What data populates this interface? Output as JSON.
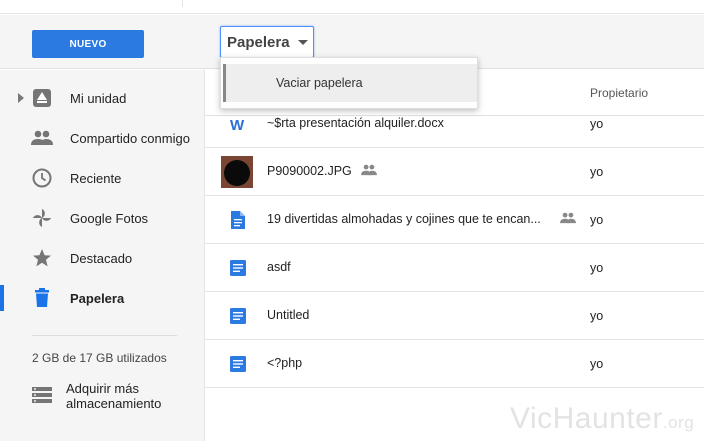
{
  "toolbar": {
    "new_label": "NUEVO",
    "trash_label": "Papelera",
    "accent_color": "#2a7ae2"
  },
  "menu": {
    "items": [
      {
        "label": "Vaciar papelera"
      }
    ]
  },
  "sidebar": {
    "items": [
      {
        "label": "Mi unidad",
        "icon": "drive-icon"
      },
      {
        "label": "Compartido conmigo",
        "icon": "people-icon"
      },
      {
        "label": "Reciente",
        "icon": "clock-icon"
      },
      {
        "label": "Google Fotos",
        "icon": "pinwheel-icon"
      },
      {
        "label": "Destacado",
        "icon": "star-icon"
      },
      {
        "label": "Papelera",
        "icon": "trash-icon",
        "active": true
      }
    ],
    "storage": "2 GB de 17 GB utilizados",
    "buy_storage": "Adquirir más almacenamiento"
  },
  "list": {
    "owner_header": "Propietario",
    "rows": [
      {
        "name": "~$rta presentación alquiler.docx",
        "icon": "word-icon",
        "owner": "yo",
        "shared": false
      },
      {
        "name": "P9090002.JPG",
        "icon": "image-thumbnail",
        "owner": "yo",
        "shared": true
      },
      {
        "name": "19 divertidas almohadas y cojines que te encan...",
        "icon": "doc-icon",
        "owner": "yo",
        "shared": true
      },
      {
        "name": "asdf",
        "icon": "docs-icon",
        "owner": "yo",
        "shared": false
      },
      {
        "name": "Untitled",
        "icon": "docs-icon",
        "owner": "yo",
        "shared": false
      },
      {
        "name": "<?php",
        "icon": "docs-icon",
        "owner": "yo",
        "shared": false
      }
    ]
  },
  "watermark": {
    "main": "VicHaunter",
    "suffix": ".org"
  }
}
